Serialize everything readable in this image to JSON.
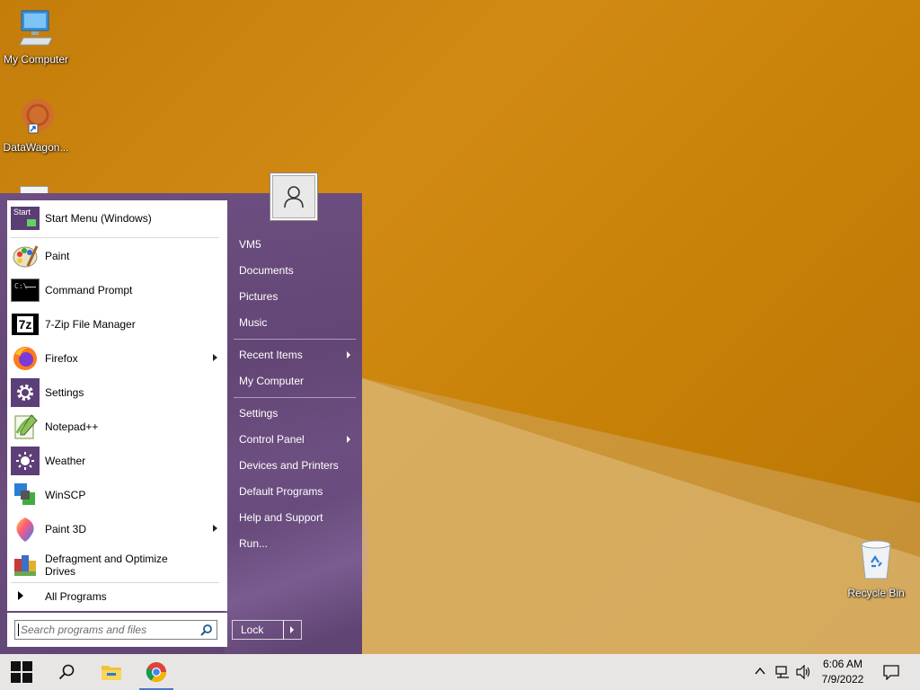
{
  "desktop": {
    "icons": [
      {
        "name": "My Computer",
        "icon": "computer-icon"
      },
      {
        "name": "DataWagon...",
        "icon": "datawagon-icon"
      },
      {
        "name": "Recycle Bin",
        "icon": "recycle-bin-icon"
      }
    ]
  },
  "start_menu": {
    "pinned": [
      {
        "label": "Start Menu (Windows)",
        "icon": "start-menu-icon",
        "has_submenu": false
      },
      {
        "label": "Paint",
        "icon": "paint-icon",
        "has_submenu": false
      },
      {
        "label": "Command Prompt",
        "icon": "command-prompt-icon",
        "has_submenu": false
      },
      {
        "label": "7-Zip File Manager",
        "icon": "7zip-icon",
        "has_submenu": false
      },
      {
        "label": "Firefox",
        "icon": "firefox-icon",
        "has_submenu": true
      },
      {
        "label": "Settings",
        "icon": "settings-icon",
        "has_submenu": false
      },
      {
        "label": "Notepad++",
        "icon": "notepadpp-icon",
        "has_submenu": false
      },
      {
        "label": "Weather",
        "icon": "weather-icon",
        "has_submenu": false
      },
      {
        "label": "WinSCP",
        "icon": "winscp-icon",
        "has_submenu": false
      },
      {
        "label": "Paint 3D",
        "icon": "paint3d-icon",
        "has_submenu": true
      },
      {
        "label": "Defragment and Optimize Drives",
        "icon": "defrag-icon",
        "has_submenu": false
      }
    ],
    "all_programs": "All Programs",
    "search_placeholder": "Search programs and files",
    "start_icon_text": "Start",
    "right_items": [
      {
        "label": "VM5",
        "has_submenu": false
      },
      {
        "label": "Documents",
        "has_submenu": false
      },
      {
        "label": "Pictures",
        "has_submenu": false
      },
      {
        "label": "Music",
        "has_submenu": false
      },
      {
        "label": "Recent Items",
        "has_submenu": true
      },
      {
        "label": "My Computer",
        "has_submenu": false
      },
      {
        "label": "Settings",
        "has_submenu": false
      },
      {
        "label": "Control Panel",
        "has_submenu": true
      },
      {
        "label": "Devices and Printers",
        "has_submenu": false
      },
      {
        "label": "Default Programs",
        "has_submenu": false
      },
      {
        "label": "Help and Support",
        "has_submenu": false
      },
      {
        "label": "Run...",
        "has_submenu": false
      }
    ],
    "lock_label": "Lock",
    "accent_color": "#6a4b7d"
  },
  "taskbar": {
    "time": "6:06 AM",
    "date": "7/9/2022",
    "items": [
      "windows-start-icon",
      "search-icon",
      "file-explorer-icon",
      "chrome-icon"
    ],
    "tray": [
      "chevron-up-icon",
      "network-icon",
      "volume-icon",
      "notification-icon"
    ]
  }
}
